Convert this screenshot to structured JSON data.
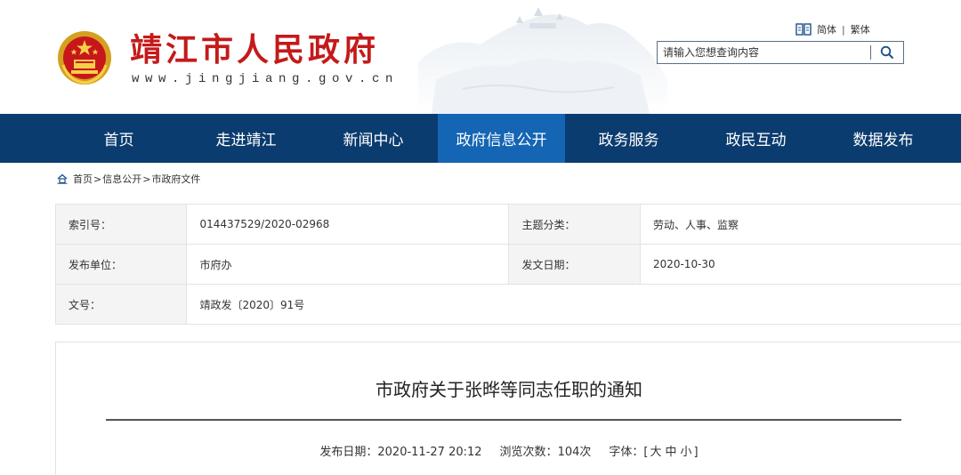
{
  "header": {
    "site_title": "靖江市人民政府",
    "site_url": "www.jingjiang.gov.cn",
    "lang_simplified": "简体",
    "lang_separator": "|",
    "lang_traditional": "繁体",
    "search_placeholder": "请输入您想查询内容",
    "icons": [
      "emblem-icon",
      "book-icon",
      "search-icon"
    ]
  },
  "nav": {
    "items": [
      "首页",
      "走进靖江",
      "新闻中心",
      "政府信息公开",
      "政务服务",
      "政民互动",
      "数据发布"
    ],
    "active_index": 3
  },
  "breadcrumb": {
    "items": [
      "首页",
      "信息公开",
      "市政府文件"
    ],
    "separator": ">"
  },
  "meta": {
    "index_label": "索引号：",
    "index_value": "014437529/2020-02968",
    "topic_label": "主题分类：",
    "topic_value": "劳动、人事、监察",
    "publisher_label": "发布单位：",
    "publisher_value": "市府办",
    "date_label": "发文日期：",
    "date_value": "2020-10-30",
    "docno_label": "文号：",
    "docno_value": "靖政发〔2020〕91号"
  },
  "article": {
    "title": "市政府关于张晔等同志任职的通知",
    "publish_label": "发布日期：",
    "publish_value": "2020-11-27 20:12",
    "views_label": "浏览次数：",
    "views_value": "104次",
    "font_label": "字体：",
    "font_open": "[",
    "font_large": "大",
    "font_medium": "中",
    "font_small": "小",
    "font_close": "]"
  },
  "colors": {
    "title_red": "#c41a1a",
    "nav_bg": "#0b3c6f",
    "nav_active": "#1565b5",
    "label_bg": "#f4f4f4"
  }
}
